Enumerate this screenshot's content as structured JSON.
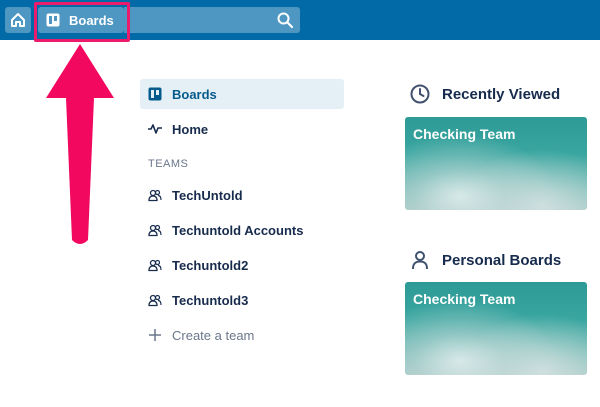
{
  "topbar": {
    "boards_label": "Boards",
    "search_value": ""
  },
  "sidebar": {
    "items": [
      {
        "label": "Boards",
        "icon": "board-icon",
        "active": true
      },
      {
        "label": "Home",
        "icon": "activity-icon",
        "active": false
      }
    ],
    "teams_heading": "TEAMS",
    "teams": [
      {
        "label": "TechUntold"
      },
      {
        "label": "Techuntold Accounts"
      },
      {
        "label": "Techuntold2"
      },
      {
        "label": "Techuntold3"
      }
    ],
    "create_team_label": "Create a team"
  },
  "recent": {
    "heading": "Recently Viewed",
    "board_title": "Checking Team"
  },
  "personal": {
    "heading": "Personal Boards",
    "board_title": "Checking Team"
  },
  "colors": {
    "topbar": "#026aa7",
    "button": "#4d97c2",
    "highlight": "#ec1c6c",
    "active_item_bg": "#e4f0f6"
  }
}
